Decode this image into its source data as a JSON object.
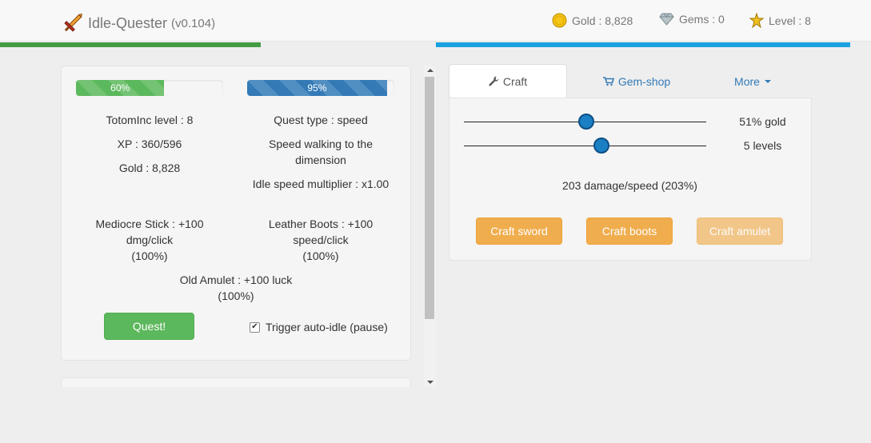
{
  "app": {
    "title": "Idle-Quester",
    "version": "(v0.104)"
  },
  "header_stats": {
    "gold": "Gold : 8,828",
    "gems": "Gems : 0",
    "level": "Level : 8"
  },
  "progress": {
    "xp": {
      "label": "60%",
      "percent": 60
    },
    "quest": {
      "label": "95%",
      "percent": 95
    }
  },
  "player": {
    "level_line": "TotomInc level : 8",
    "xp_line": "XP : 360/596",
    "gold_line": "Gold : 8,828"
  },
  "quest": {
    "type_line": "Quest type : speed",
    "desc_line1": "Speed walking to the",
    "desc_line2": "dimension",
    "multiplier_line": "Idle speed multiplier : x1.00"
  },
  "equipment": {
    "weapon": {
      "line1": "Mediocre Stick : +100",
      "line2": "dmg/click",
      "line3": "(100%)"
    },
    "boots": {
      "line1": "Leather Boots : +100",
      "line2": "speed/click",
      "line3": "(100%)"
    },
    "amulet": {
      "line1": "Old Amulet : +100 luck",
      "line2": "(100%)"
    }
  },
  "actions": {
    "quest_button": "Quest!",
    "auto_idle_label": "Trigger auto-idle (pause)",
    "auto_idle_checked": true
  },
  "tabs": [
    {
      "label": "Craft",
      "icon": "wrench-icon",
      "active": true
    },
    {
      "label": "Gem-shop",
      "icon": "cart-icon",
      "active": false
    },
    {
      "label": "More",
      "icon": "caret-down-icon",
      "active": false
    }
  ],
  "craft": {
    "gold_slider": {
      "label": "51% gold",
      "value": 51
    },
    "levels_slider": {
      "label": "5 levels",
      "value": 5
    },
    "result_line": "203 damage/speed (203%)",
    "buttons": {
      "sword": "Craft sword",
      "boots": "Craft boots",
      "amulet": "Craft amulet"
    }
  },
  "colors": {
    "xp_bar": "#5cb85c",
    "quest_bar": "#337ab7",
    "top_green": "#449d44",
    "top_blue": "#1aa1e1",
    "craft_button": "#f0ad4e",
    "quest_button": "#5cb85c"
  }
}
